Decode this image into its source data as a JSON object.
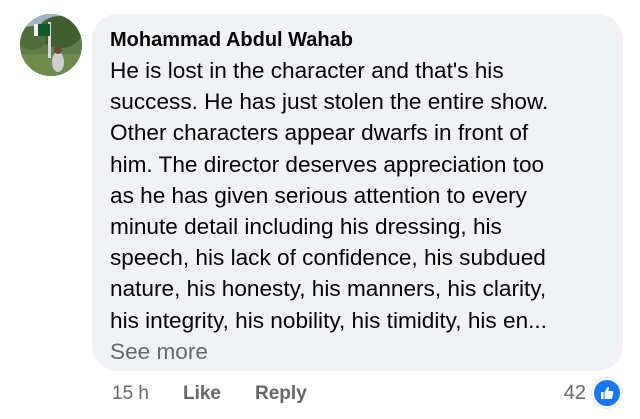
{
  "comment": {
    "author": "Mohammad Abdul Wahab",
    "lines": [
      "He is lost in the character and that's his",
      "success. He has just stolen the entire show.",
      "Other characters appear dwarfs in front of",
      "him. The director deserves appreciation too",
      "as he has given serious attention to every",
      "minute detail including his dressing, his",
      "speech, his lack of confidence, his subdued",
      "nature, his honesty, his manners, his clarity,",
      "his integrity, his nobility, his timidity, his en..."
    ],
    "see_more": "See more"
  },
  "actions": {
    "time": "15 h",
    "like": "Like",
    "reply": "Reply"
  },
  "reactions": {
    "count": "42",
    "icon": "thumbs-up-icon",
    "icon_color": "#1877f2"
  },
  "colors": {
    "bubble": "#f0f2f5",
    "text": "#050505",
    "secondary": "#65676b"
  }
}
